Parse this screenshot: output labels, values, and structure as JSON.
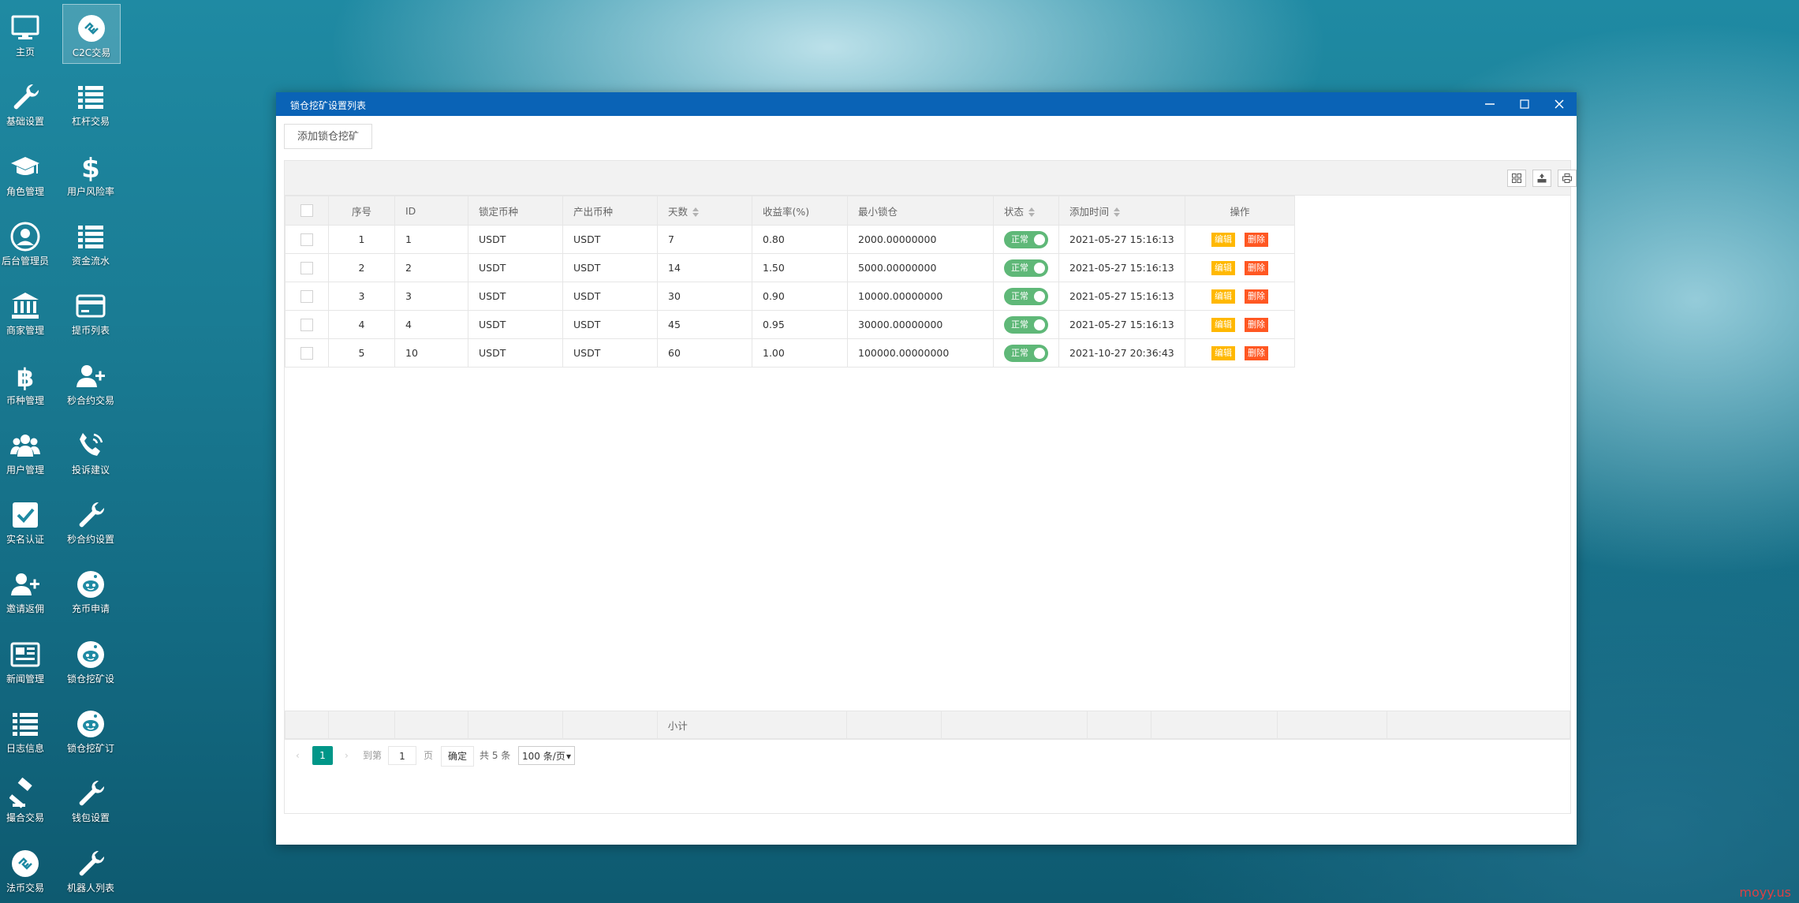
{
  "desktop": {
    "icons": [
      {
        "label": "主页",
        "icon": "monitor-icon"
      },
      {
        "label": "C2C交易",
        "icon": "exchange-icon"
      },
      {
        "label": "基础设置",
        "icon": "wrench-icon"
      },
      {
        "label": "杠杆交易",
        "icon": "list-icon"
      },
      {
        "label": "角色管理",
        "icon": "graduation-cap-icon"
      },
      {
        "label": "用户风险率",
        "icon": "dollar-icon"
      },
      {
        "label": "后台管理员",
        "icon": "user-circle-icon"
      },
      {
        "label": "资金流水",
        "icon": "list-icon"
      },
      {
        "label": "商家管理",
        "icon": "bank-icon"
      },
      {
        "label": "提币列表",
        "icon": "credit-card-icon"
      },
      {
        "label": "币种管理",
        "icon": "bitcoin-icon"
      },
      {
        "label": "秒合约交易",
        "icon": "user-plus-icon"
      },
      {
        "label": "用户管理",
        "icon": "users-icon"
      },
      {
        "label": "投诉建议",
        "icon": "phone-icon"
      },
      {
        "label": "实名认证",
        "icon": "check-square-icon"
      },
      {
        "label": "秒合约设置",
        "icon": "wrench-icon"
      },
      {
        "label": "邀请返佣",
        "icon": "user-plus-icon"
      },
      {
        "label": "充币申请",
        "icon": "reddit-icon"
      },
      {
        "label": "新闻管理",
        "icon": "newspaper-icon"
      },
      {
        "label": "锁仓挖矿设",
        "icon": "reddit-icon"
      },
      {
        "label": "日志信息",
        "icon": "list-icon"
      },
      {
        "label": "锁仓挖矿订",
        "icon": "reddit-icon"
      },
      {
        "label": "撮合交易",
        "icon": "gavel-icon"
      },
      {
        "label": "钱包设置",
        "icon": "wrench-icon"
      },
      {
        "label": "法币交易",
        "icon": "exchange-icon"
      },
      {
        "label": "机器人列表",
        "icon": "wrench-icon"
      }
    ]
  },
  "window": {
    "title": "锁仓挖矿设置列表",
    "add_button": "添加锁仓挖矿"
  },
  "table": {
    "columns": [
      "序号",
      "ID",
      "锁定币种",
      "产出币种",
      "天数",
      "收益率(%)",
      "最小锁仓",
      "状态",
      "添加时间",
      "操作"
    ],
    "rows": [
      {
        "no": "1",
        "id": "1",
        "lock_coin": "USDT",
        "out_coin": "USDT",
        "days": "7",
        "rate": "0.80",
        "min_lock": "2000.00000000",
        "status": "正常",
        "time": "2021-05-27 15:16:13"
      },
      {
        "no": "2",
        "id": "2",
        "lock_coin": "USDT",
        "out_coin": "USDT",
        "days": "14",
        "rate": "1.50",
        "min_lock": "5000.00000000",
        "status": "正常",
        "time": "2021-05-27 15:16:13"
      },
      {
        "no": "3",
        "id": "3",
        "lock_coin": "USDT",
        "out_coin": "USDT",
        "days": "30",
        "rate": "0.90",
        "min_lock": "10000.00000000",
        "status": "正常",
        "time": "2021-05-27 15:16:13"
      },
      {
        "no": "4",
        "id": "4",
        "lock_coin": "USDT",
        "out_coin": "USDT",
        "days": "45",
        "rate": "0.95",
        "min_lock": "30000.00000000",
        "status": "正常",
        "time": "2021-05-27 15:16:13"
      },
      {
        "no": "5",
        "id": "10",
        "lock_coin": "USDT",
        "out_coin": "USDT",
        "days": "60",
        "rate": "1.00",
        "min_lock": "100000.00000000",
        "status": "正常",
        "time": "2021-10-27 20:36:43"
      }
    ],
    "edit_label": "编辑",
    "delete_label": "删除",
    "subtotal_label": "小计"
  },
  "pager": {
    "current": "1",
    "goto_label": "到第",
    "page_input": "1",
    "page_unit": "页",
    "confirm_label": "确定",
    "total_text": "共 5 条",
    "page_size": "100 条/页"
  },
  "watermark": "moyy.us",
  "colors": {
    "titlebar": "#0a63b6",
    "switch_on": "#5fb878",
    "edit": "#ffb800",
    "delete": "#ff5722",
    "page_current": "#009688"
  }
}
